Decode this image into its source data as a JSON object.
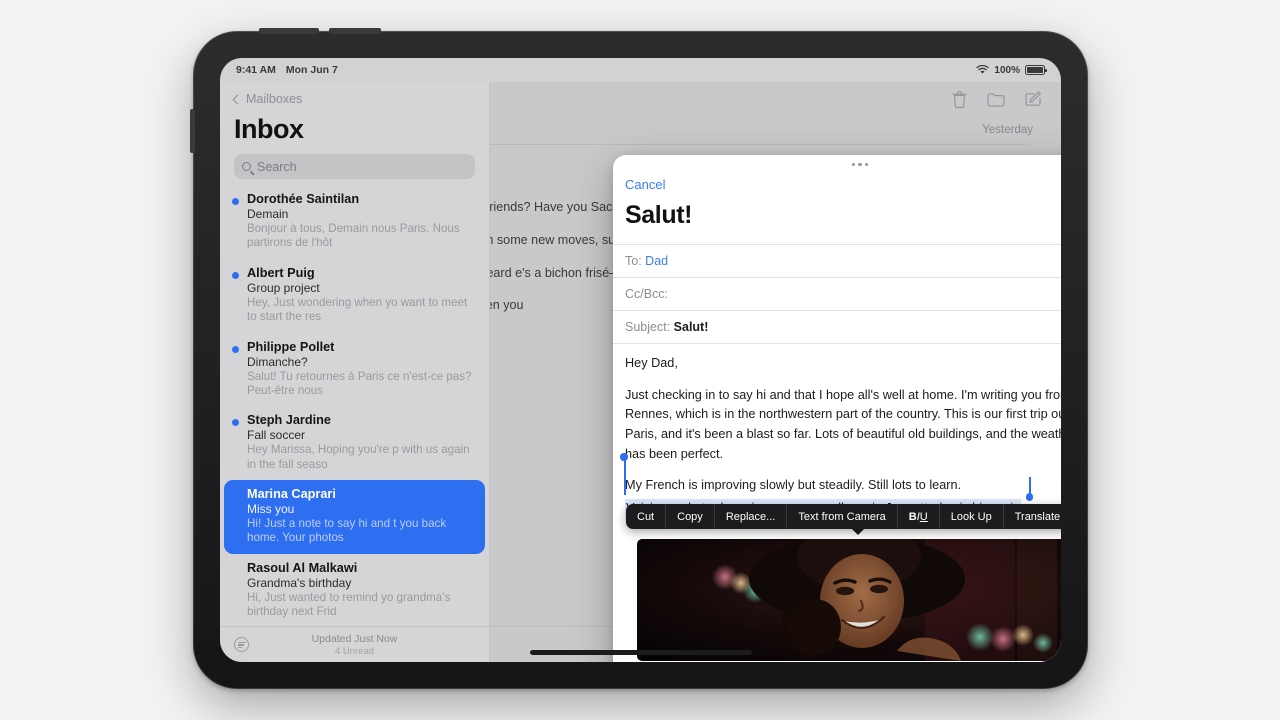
{
  "status_bar": {
    "time": "9:41 AM",
    "date": "Mon Jun 7",
    "battery_percent": "100%",
    "wifi_icon": "wifi-icon"
  },
  "sidebar": {
    "back_label": "Mailboxes",
    "title": "Inbox",
    "search_placeholder": "Search",
    "messages": [
      {
        "sender": "Dorothée Saintilan",
        "subject": "Demain",
        "preview": "Bonjour à tous, Demain nous Paris. Nous partirons de l'hôt",
        "unread": true,
        "selected": false
      },
      {
        "sender": "Albert Puig",
        "subject": "Group project",
        "preview": "Hey, Just wondering when yo want to meet to start the res",
        "unread": true,
        "selected": false
      },
      {
        "sender": "Philippe Pollet",
        "subject": "Dimanche?",
        "preview": "Salut! Tu retournes à Paris ce n'est-ce pas? Peut-être nous",
        "unread": true,
        "selected": false
      },
      {
        "sender": "Steph Jardine",
        "subject": "Fall soccer",
        "preview": "Hey Marissa, Hoping you're p with us again in the fall seaso",
        "unread": true,
        "selected": false
      },
      {
        "sender": "Marina Caprari",
        "subject": "Miss you",
        "preview": "Hi! Just a note to say hi and t you back home. Your photos",
        "unread": false,
        "selected": true
      },
      {
        "sender": "Rasoul Al Malkawi",
        "subject": "Grandma's birthday",
        "preview": "Hi, Just wanted to remind yo grandma's birthday next Frid",
        "unread": false,
        "selected": false
      }
    ],
    "footer": {
      "filter_icon": "filter-icon",
      "updated": "Updated Just Now",
      "unread_count": "4 Unread"
    }
  },
  "reading_pane": {
    "toolbar_icons": [
      "trash-icon",
      "folder-icon",
      "compose-icon"
    ],
    "date": "Yesterday",
    "paragraphs": [
      "ur photos are of friends? Have you Sacre Coeur? Tell icariously through",
      "for next soccer ith some new moves, summer. 😈⚽ I got a and make a little ! Kind of makes me",
      "obably already heard e's a bichon frisé—so",
      "e more news when you"
    ],
    "reply_icon": "reply-icon"
  },
  "compose": {
    "grabber_icon": "grabber-handle",
    "cancel_label": "Cancel",
    "title": "Salut!",
    "send_icon": "send-arrow-up-icon",
    "to_label": "To:",
    "to_value": "Dad",
    "add_recipient_icon": "add-contact-icon",
    "cc_label": "Cc/Bcc:",
    "cc_value": "",
    "subject_label": "Subject:",
    "subject_value": "Salut!",
    "body": {
      "greeting": "Hey Dad,",
      "paragraph1": "Just checking in to say hi and that I hope all's well at home. I'm writing you from Rennes, which is in the northwestern part of the country. This is our first trip outside Paris, and it's been a blast so far. Lots of beautiful old buildings, and the weather has been perfect.",
      "paragraph2": "My French is improving slowly but steadily. Still lots to learn.",
      "selected_text": "Voici une photo de moi que ma nouvelle amie Jeanette à pris hier soir."
    },
    "attachment_alt": "photo-attachment"
  },
  "context_menu": {
    "items": [
      {
        "label": "Cut",
        "kind": "text"
      },
      {
        "label": "Copy",
        "kind": "text"
      },
      {
        "label": "Replace...",
        "kind": "text"
      },
      {
        "label": "Text from Camera",
        "kind": "text"
      },
      {
        "label": "BIU",
        "kind": "format"
      },
      {
        "label": "Look Up",
        "kind": "text"
      },
      {
        "label": "Translate",
        "kind": "text"
      },
      {
        "label": "",
        "kind": "more"
      }
    ]
  },
  "colors": {
    "accent_blue": "#2e6ef0",
    "link_blue": "#3b7ef0",
    "selection_blue": "#d3e2fb",
    "menu_black": "#1c1c1e"
  }
}
